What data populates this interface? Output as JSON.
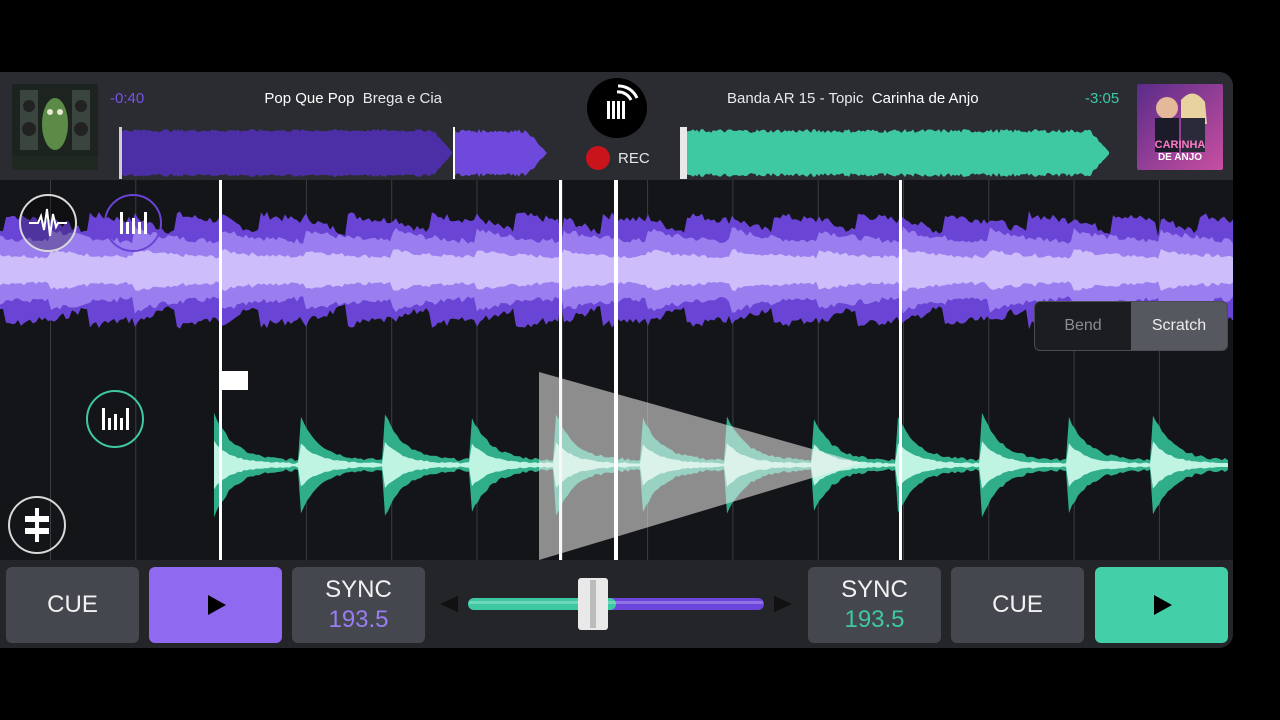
{
  "deck_a": {
    "time_remaining": "-0:40",
    "artist": "Pop Que  Pop",
    "title": "Brega e Cia",
    "accent": "#7a52e8",
    "cue_label": "CUE",
    "sync_label": "SYNC",
    "bpm": "193.5",
    "play_icon": "play-icon",
    "overview_progress": 0.76
  },
  "deck_b": {
    "time_remaining": "-3:05",
    "artist": "Banda AR 15 - Topic",
    "title": "Carinha de Anjo",
    "accent": "#3ec9a3",
    "cue_label": "CUE",
    "sync_label": "SYNC",
    "bpm": "193.5",
    "play_icon": "play-icon",
    "overview_progress": 0.0,
    "cover_text": "CARINHA DE ANJO"
  },
  "center": {
    "rec_label": "REC",
    "hub_icon": "broadcast-icon"
  },
  "wave_modes": {
    "bend_label": "Bend",
    "scratch_label": "Scratch",
    "active": "Scratch"
  },
  "crossfader": {
    "position": 0.5
  },
  "colors": {
    "purple": "#7a52e8",
    "purple_light": "#c9b6fb",
    "teal": "#3ec9a3",
    "teal_light": "#bff3e2",
    "rec": "#c8141a"
  }
}
